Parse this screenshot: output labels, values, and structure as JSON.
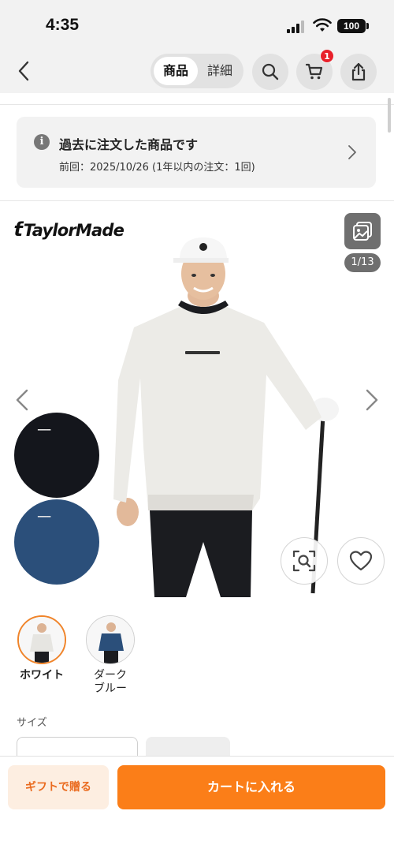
{
  "status_bar": {
    "time": "4:35",
    "battery": "100"
  },
  "nav": {
    "back_icon": "chevron-left-icon",
    "tabs": [
      {
        "label": "商品",
        "active": true
      },
      {
        "label": "詳細",
        "active": false
      }
    ],
    "cart_badge_count": "1"
  },
  "past_order": {
    "title": "過去に注文した商品です",
    "subtitle": "前回：2025/10/26 (1年以内の注文：1回)"
  },
  "gallery": {
    "brand": "TaylorMade",
    "image_counter": "1/13"
  },
  "color_variants": [
    {
      "label": "ホワイト",
      "selected": true
    },
    {
      "label": "ダーク\nブルー",
      "selected": false
    }
  ],
  "size_section": {
    "label": "サイズ"
  },
  "actions": {
    "gift_label": "ギフトで贈る",
    "cart_label": "カートに入れる"
  },
  "colors": {
    "accent_orange": "#fb7e18",
    "gift_bg": "#fdeee1",
    "badge_red": "#e8202a"
  }
}
